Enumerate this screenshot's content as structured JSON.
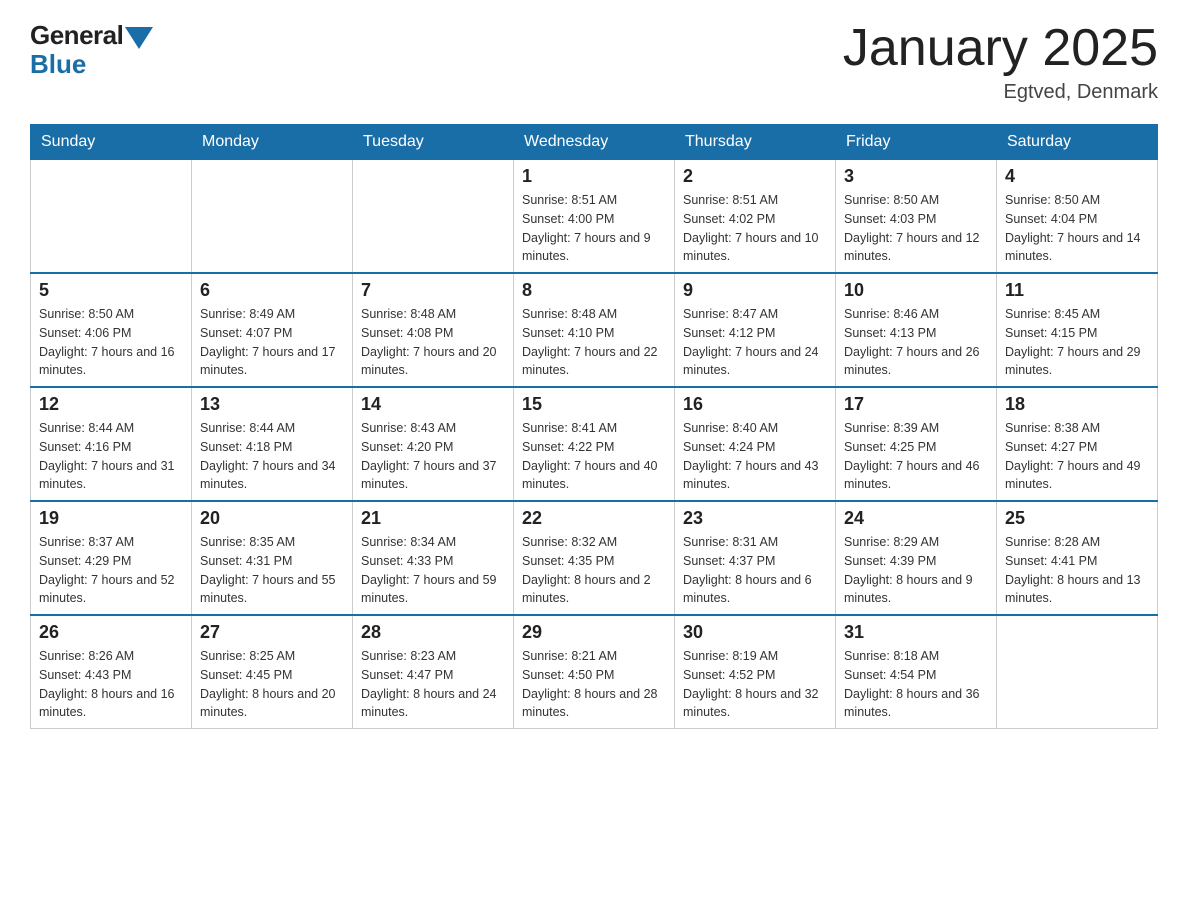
{
  "logo": {
    "general": "General",
    "blue": "Blue"
  },
  "header": {
    "title": "January 2025",
    "subtitle": "Egtved, Denmark"
  },
  "weekdays": [
    "Sunday",
    "Monday",
    "Tuesday",
    "Wednesday",
    "Thursday",
    "Friday",
    "Saturday"
  ],
  "weeks": [
    [
      {
        "day": "",
        "info": ""
      },
      {
        "day": "",
        "info": ""
      },
      {
        "day": "",
        "info": ""
      },
      {
        "day": "1",
        "sunrise": "Sunrise: 8:51 AM",
        "sunset": "Sunset: 4:00 PM",
        "daylight": "Daylight: 7 hours and 9 minutes."
      },
      {
        "day": "2",
        "sunrise": "Sunrise: 8:51 AM",
        "sunset": "Sunset: 4:02 PM",
        "daylight": "Daylight: 7 hours and 10 minutes."
      },
      {
        "day": "3",
        "sunrise": "Sunrise: 8:50 AM",
        "sunset": "Sunset: 4:03 PM",
        "daylight": "Daylight: 7 hours and 12 minutes."
      },
      {
        "day": "4",
        "sunrise": "Sunrise: 8:50 AM",
        "sunset": "Sunset: 4:04 PM",
        "daylight": "Daylight: 7 hours and 14 minutes."
      }
    ],
    [
      {
        "day": "5",
        "sunrise": "Sunrise: 8:50 AM",
        "sunset": "Sunset: 4:06 PM",
        "daylight": "Daylight: 7 hours and 16 minutes."
      },
      {
        "day": "6",
        "sunrise": "Sunrise: 8:49 AM",
        "sunset": "Sunset: 4:07 PM",
        "daylight": "Daylight: 7 hours and 17 minutes."
      },
      {
        "day": "7",
        "sunrise": "Sunrise: 8:48 AM",
        "sunset": "Sunset: 4:08 PM",
        "daylight": "Daylight: 7 hours and 20 minutes."
      },
      {
        "day": "8",
        "sunrise": "Sunrise: 8:48 AM",
        "sunset": "Sunset: 4:10 PM",
        "daylight": "Daylight: 7 hours and 22 minutes."
      },
      {
        "day": "9",
        "sunrise": "Sunrise: 8:47 AM",
        "sunset": "Sunset: 4:12 PM",
        "daylight": "Daylight: 7 hours and 24 minutes."
      },
      {
        "day": "10",
        "sunrise": "Sunrise: 8:46 AM",
        "sunset": "Sunset: 4:13 PM",
        "daylight": "Daylight: 7 hours and 26 minutes."
      },
      {
        "day": "11",
        "sunrise": "Sunrise: 8:45 AM",
        "sunset": "Sunset: 4:15 PM",
        "daylight": "Daylight: 7 hours and 29 minutes."
      }
    ],
    [
      {
        "day": "12",
        "sunrise": "Sunrise: 8:44 AM",
        "sunset": "Sunset: 4:16 PM",
        "daylight": "Daylight: 7 hours and 31 minutes."
      },
      {
        "day": "13",
        "sunrise": "Sunrise: 8:44 AM",
        "sunset": "Sunset: 4:18 PM",
        "daylight": "Daylight: 7 hours and 34 minutes."
      },
      {
        "day": "14",
        "sunrise": "Sunrise: 8:43 AM",
        "sunset": "Sunset: 4:20 PM",
        "daylight": "Daylight: 7 hours and 37 minutes."
      },
      {
        "day": "15",
        "sunrise": "Sunrise: 8:41 AM",
        "sunset": "Sunset: 4:22 PM",
        "daylight": "Daylight: 7 hours and 40 minutes."
      },
      {
        "day": "16",
        "sunrise": "Sunrise: 8:40 AM",
        "sunset": "Sunset: 4:24 PM",
        "daylight": "Daylight: 7 hours and 43 minutes."
      },
      {
        "day": "17",
        "sunrise": "Sunrise: 8:39 AM",
        "sunset": "Sunset: 4:25 PM",
        "daylight": "Daylight: 7 hours and 46 minutes."
      },
      {
        "day": "18",
        "sunrise": "Sunrise: 8:38 AM",
        "sunset": "Sunset: 4:27 PM",
        "daylight": "Daylight: 7 hours and 49 minutes."
      }
    ],
    [
      {
        "day": "19",
        "sunrise": "Sunrise: 8:37 AM",
        "sunset": "Sunset: 4:29 PM",
        "daylight": "Daylight: 7 hours and 52 minutes."
      },
      {
        "day": "20",
        "sunrise": "Sunrise: 8:35 AM",
        "sunset": "Sunset: 4:31 PM",
        "daylight": "Daylight: 7 hours and 55 minutes."
      },
      {
        "day": "21",
        "sunrise": "Sunrise: 8:34 AM",
        "sunset": "Sunset: 4:33 PM",
        "daylight": "Daylight: 7 hours and 59 minutes."
      },
      {
        "day": "22",
        "sunrise": "Sunrise: 8:32 AM",
        "sunset": "Sunset: 4:35 PM",
        "daylight": "Daylight: 8 hours and 2 minutes."
      },
      {
        "day": "23",
        "sunrise": "Sunrise: 8:31 AM",
        "sunset": "Sunset: 4:37 PM",
        "daylight": "Daylight: 8 hours and 6 minutes."
      },
      {
        "day": "24",
        "sunrise": "Sunrise: 8:29 AM",
        "sunset": "Sunset: 4:39 PM",
        "daylight": "Daylight: 8 hours and 9 minutes."
      },
      {
        "day": "25",
        "sunrise": "Sunrise: 8:28 AM",
        "sunset": "Sunset: 4:41 PM",
        "daylight": "Daylight: 8 hours and 13 minutes."
      }
    ],
    [
      {
        "day": "26",
        "sunrise": "Sunrise: 8:26 AM",
        "sunset": "Sunset: 4:43 PM",
        "daylight": "Daylight: 8 hours and 16 minutes."
      },
      {
        "day": "27",
        "sunrise": "Sunrise: 8:25 AM",
        "sunset": "Sunset: 4:45 PM",
        "daylight": "Daylight: 8 hours and 20 minutes."
      },
      {
        "day": "28",
        "sunrise": "Sunrise: 8:23 AM",
        "sunset": "Sunset: 4:47 PM",
        "daylight": "Daylight: 8 hours and 24 minutes."
      },
      {
        "day": "29",
        "sunrise": "Sunrise: 8:21 AM",
        "sunset": "Sunset: 4:50 PM",
        "daylight": "Daylight: 8 hours and 28 minutes."
      },
      {
        "day": "30",
        "sunrise": "Sunrise: 8:19 AM",
        "sunset": "Sunset: 4:52 PM",
        "daylight": "Daylight: 8 hours and 32 minutes."
      },
      {
        "day": "31",
        "sunrise": "Sunrise: 8:18 AM",
        "sunset": "Sunset: 4:54 PM",
        "daylight": "Daylight: 8 hours and 36 minutes."
      },
      {
        "day": "",
        "info": ""
      }
    ]
  ]
}
